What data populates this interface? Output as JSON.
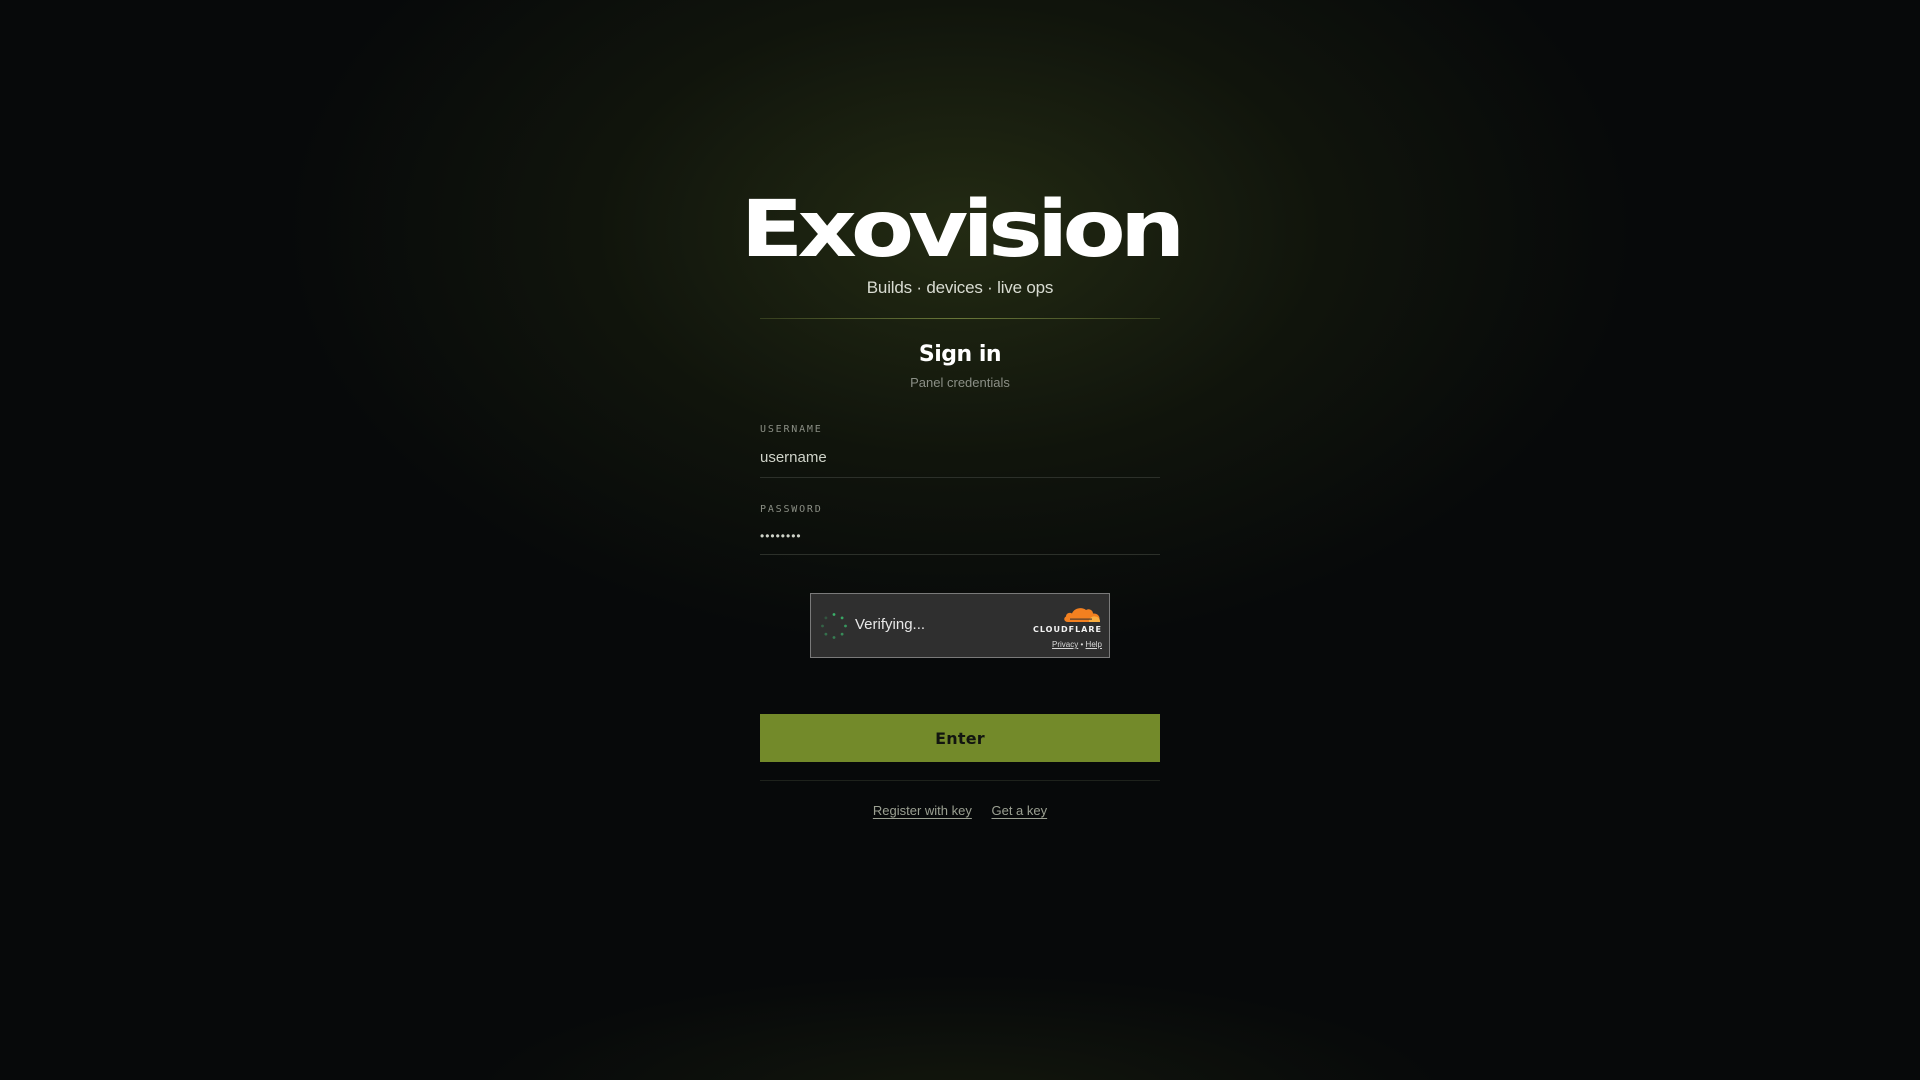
{
  "brand": {
    "name": "Exovision",
    "tagline": "Builds · devices · live ops"
  },
  "signin": {
    "title": "Sign in",
    "subtitle": "Panel credentials"
  },
  "form": {
    "username": {
      "label": "USERNAME",
      "placeholder": "username"
    },
    "password": {
      "label": "PASSWORD",
      "placeholder": "••••••••"
    },
    "submit_label": "Enter"
  },
  "captcha": {
    "status": "Verifying...",
    "provider": "CLOUDFLARE",
    "privacy_label": "Privacy",
    "separator": "•",
    "help_label": "Help"
  },
  "footer_links": {
    "register": "Register with key",
    "get_key": "Get a key"
  },
  "colors": {
    "accent": "#738a2a",
    "background": "#07090a",
    "cloudflare_orange": "#f38020",
    "spinner_green": "#3ab26a"
  },
  "icons": {
    "spinner": "loading-spinner-icon",
    "cloudflare": "cloudflare-cloud-icon"
  }
}
